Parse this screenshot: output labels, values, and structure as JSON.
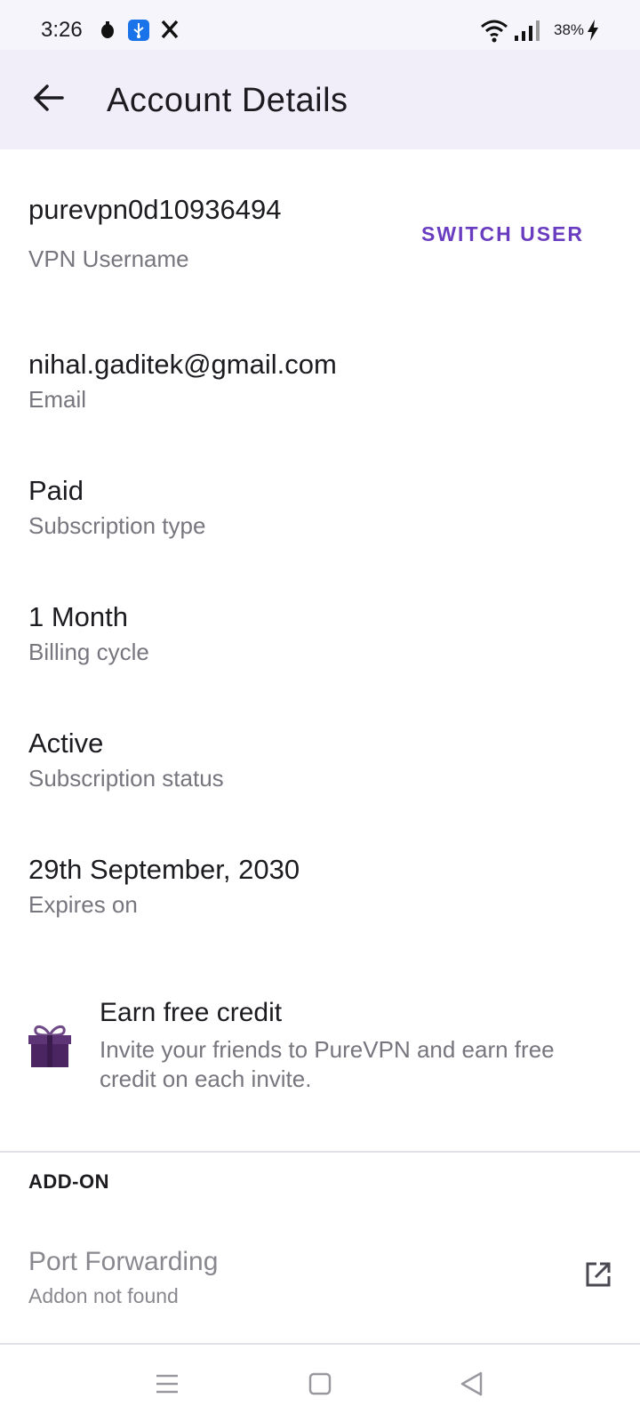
{
  "status_bar": {
    "time": "3:26",
    "battery": "38%",
    "icons": [
      "notification-icon",
      "usb-icon",
      "x-app-icon",
      "wifi-icon",
      "signal-icon",
      "charging-icon"
    ]
  },
  "app_bar": {
    "title": "Account Details",
    "back_icon": "arrow-left-icon"
  },
  "account": {
    "username": "purevpn0d10936494",
    "username_label": "VPN Username",
    "switch_user": "SWITCH USER",
    "email": "nihal.gaditek@gmail.com",
    "email_label": "Email",
    "subscription_type": "Paid",
    "subscription_type_label": "Subscription type",
    "billing_cycle": "1 Month",
    "billing_cycle_label": "Billing cycle",
    "subscription_status": "Active",
    "subscription_status_label": "Subscription status",
    "expires_on": "29th September, 2030",
    "expires_on_label": "Expires on"
  },
  "credit": {
    "icon": "gift-icon",
    "title": "Earn free credit",
    "description": "Invite your friends to PureVPN and earn free credit on each invite."
  },
  "addon_section": {
    "header": "ADD-ON",
    "items": [
      {
        "title": "Port Forwarding",
        "status": "Addon not found",
        "icon": "external-link-icon"
      }
    ]
  },
  "nav_bar": {
    "icons": [
      "menu-icon",
      "home-square-icon",
      "back-triangle-icon"
    ]
  },
  "colors": {
    "accent": "#6a3dc0",
    "app_bar_bg": "#f1eefa",
    "gift": "#4a2561"
  }
}
